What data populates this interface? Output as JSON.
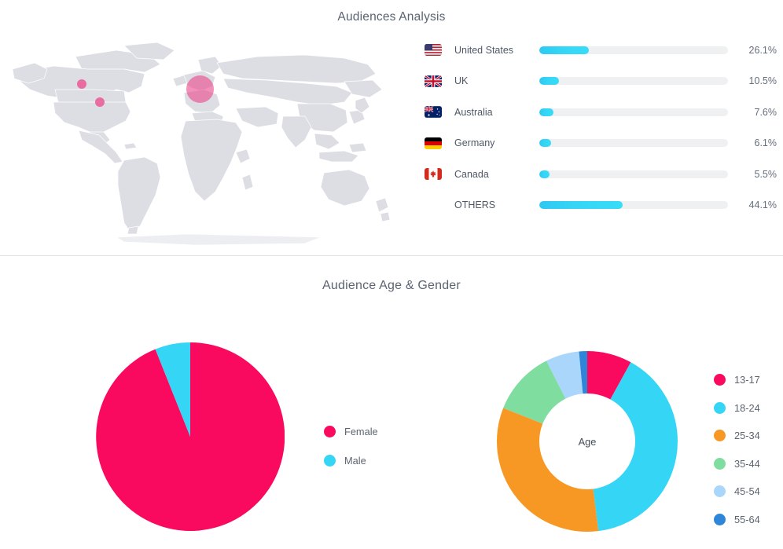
{
  "panels": {
    "audiences_title": "Audiences Analysis",
    "age_gender_title": "Audience Age & Gender"
  },
  "map": {
    "name": "world-map",
    "land_color": "#dcdee4",
    "bubble_color": "#ec4b8c",
    "bubbles": [
      {
        "name": "bubble-north-west-usa",
        "x": 96,
        "y": 105,
        "size": 12,
        "opacity": 0.78
      },
      {
        "name": "bubble-central-usa",
        "x": 119,
        "y": 128,
        "size": 12,
        "opacity": 0.78
      },
      {
        "name": "bubble-europe",
        "x": 254,
        "y": 111,
        "size": 35,
        "opacity": 0.62
      }
    ]
  },
  "countries": {
    "track_color": "#eef0f2",
    "fill_color": "#35d6f5",
    "rows": [
      {
        "flag": "flag-us",
        "name": "United States",
        "percent": "26.1%",
        "value": 26.1
      },
      {
        "flag": "flag-uk",
        "name": "UK",
        "percent": "10.5%",
        "value": 10.5
      },
      {
        "flag": "flag-australia",
        "name": "Australia",
        "percent": "7.6%",
        "value": 7.6
      },
      {
        "flag": "flag-germany",
        "name": "Germany",
        "percent": "6.1%",
        "value": 6.1
      },
      {
        "flag": "flag-canada",
        "name": "Canada",
        "percent": "5.5%",
        "value": 5.5
      },
      {
        "flag": "flag-none",
        "name": "OTHERS",
        "percent": "44.1%",
        "value": 44.1
      }
    ]
  },
  "gender": {
    "legend": [
      {
        "label": "Female",
        "color": "#fa0a5f"
      },
      {
        "label": "Male",
        "color": "#35d6f5"
      }
    ]
  },
  "age": {
    "center_label": "Age",
    "legend": [
      {
        "label": "13-17",
        "color": "#fa0a5f"
      },
      {
        "label": "18-24",
        "color": "#35d6f5"
      },
      {
        "label": "25-34",
        "color": "#f79824"
      },
      {
        "label": "35-44",
        "color": "#7fdda0"
      },
      {
        "label": "45-54",
        "color": "#a9d6fa"
      },
      {
        "label": "55-64",
        "color": "#2f86d8"
      }
    ]
  },
  "chart_data": [
    {
      "type": "pie",
      "name": "gender-pie-chart",
      "title": "Audience Age & Gender",
      "categories": [
        "Female",
        "Male"
      ],
      "values": [
        93.9,
        6.1
      ],
      "colors": [
        "#fa0a5f",
        "#35d6f5"
      ],
      "legend_position": "right",
      "start_angle_deg": 0,
      "direction": "clockwise"
    },
    {
      "type": "pie",
      "name": "age-donut-chart",
      "title": "Age",
      "donut": true,
      "inner_radius_ratio": 0.56,
      "categories": [
        "13-17",
        "18-24",
        "25-34",
        "35-44",
        "45-54",
        "55-64"
      ],
      "values": [
        8.0,
        40.0,
        33.0,
        11.5,
        6.0,
        1.5
      ],
      "colors": [
        "#fa0a5f",
        "#35d6f5",
        "#f79824",
        "#7fdda0",
        "#a9d6fa",
        "#2f86d8"
      ],
      "legend_position": "right",
      "start_angle_deg": 0,
      "direction": "clockwise"
    },
    {
      "type": "bar",
      "name": "country-audience-bars",
      "title": "Audiences Analysis",
      "orientation": "horizontal",
      "categories": [
        "United States",
        "UK",
        "Australia",
        "Germany",
        "Canada",
        "OTHERS"
      ],
      "values": [
        26.1,
        10.5,
        7.6,
        6.1,
        5.5,
        44.1
      ],
      "value_labels": [
        "26.1%",
        "10.5%",
        "7.6%",
        "6.1%",
        "5.5%",
        "44.1%"
      ],
      "xlabel": "",
      "ylabel": "",
      "xlim": [
        0,
        100
      ],
      "grid": false,
      "series_color": "#35d6f5"
    }
  ]
}
